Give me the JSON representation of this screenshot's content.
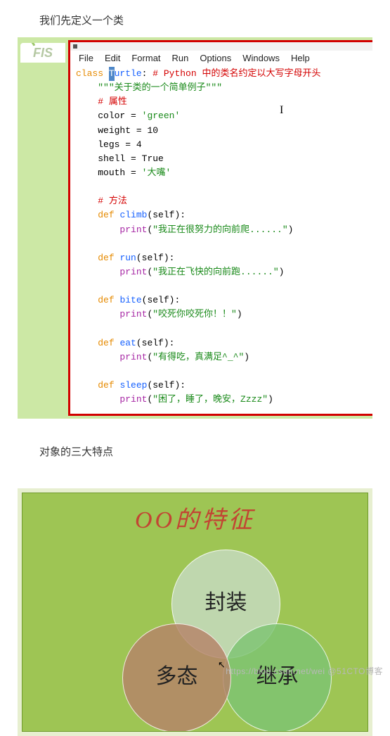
{
  "heading1": "我们先定义一个类",
  "heading2": "对象的三大特点",
  "logo_text": "FIS",
  "menubar": [
    "File",
    "Edit",
    "Format",
    "Run",
    "Options",
    "Windows",
    "Help"
  ],
  "code": {
    "l1_class": "class ",
    "l1_sel": "T",
    "l1_name": "urtle",
    "l1_colon": ": ",
    "l1_comment": "# Python 中的类名约定以大写字母开头",
    "l2": "\"\"\"关于类的一个简单例子\"\"\"",
    "l3": "# 属性",
    "l4_a": "color = ",
    "l4_b": "'green'",
    "l5_a": "weight = ",
    "l5_b": "10",
    "l6_a": "legs = ",
    "l6_b": "4",
    "l7_a": "shell = ",
    "l7_b": "True",
    "l8_a": "mouth = ",
    "l8_b": "'大嘴'",
    "l_blank": "",
    "l10": "# 方法",
    "l11_a": "def ",
    "l11_b": "climb",
    "l11_c": "(self):",
    "l12_a": "print",
    "l12_b": "(",
    "l12_c": "\"我正在很努力的向前爬......\"",
    "l12_d": ")",
    "l13_a": "def ",
    "l13_b": "run",
    "l13_c": "(self):",
    "l14_a": "print",
    "l14_b": "(",
    "l14_c": "\"我正在飞快的向前跑......\"",
    "l14_d": ")",
    "l15_a": "def ",
    "l15_b": "bite",
    "l15_c": "(self):",
    "l16_a": "print",
    "l16_b": "(",
    "l16_c": "\"咬死你咬死你！！\"",
    "l16_d": ")",
    "l17_a": "def ",
    "l17_b": "eat",
    "l17_c": "(self):",
    "l18_a": "print",
    "l18_b": "(",
    "l18_c": "\"有得吃，真满足^_^\"",
    "l18_d": ")",
    "l19_a": "def ",
    "l19_b": "sleep",
    "l19_c": "(self):",
    "l20_a": "print",
    "l20_b": "(",
    "l20_c": "\"困了，睡了，晚安，Zzzz\"",
    "l20_d": ")"
  },
  "oo": {
    "title": "OO的特征",
    "top": "封装",
    "left": "多态",
    "right": "继承"
  },
  "watermark": "https://blog.csdn.net/wei @51CTO博客",
  "chart_data": {
    "type": "venn",
    "title": "OO的特征",
    "sets": [
      "封装",
      "多态",
      "继承"
    ],
    "note": "three overlapping circles (equal size), no numeric values"
  }
}
